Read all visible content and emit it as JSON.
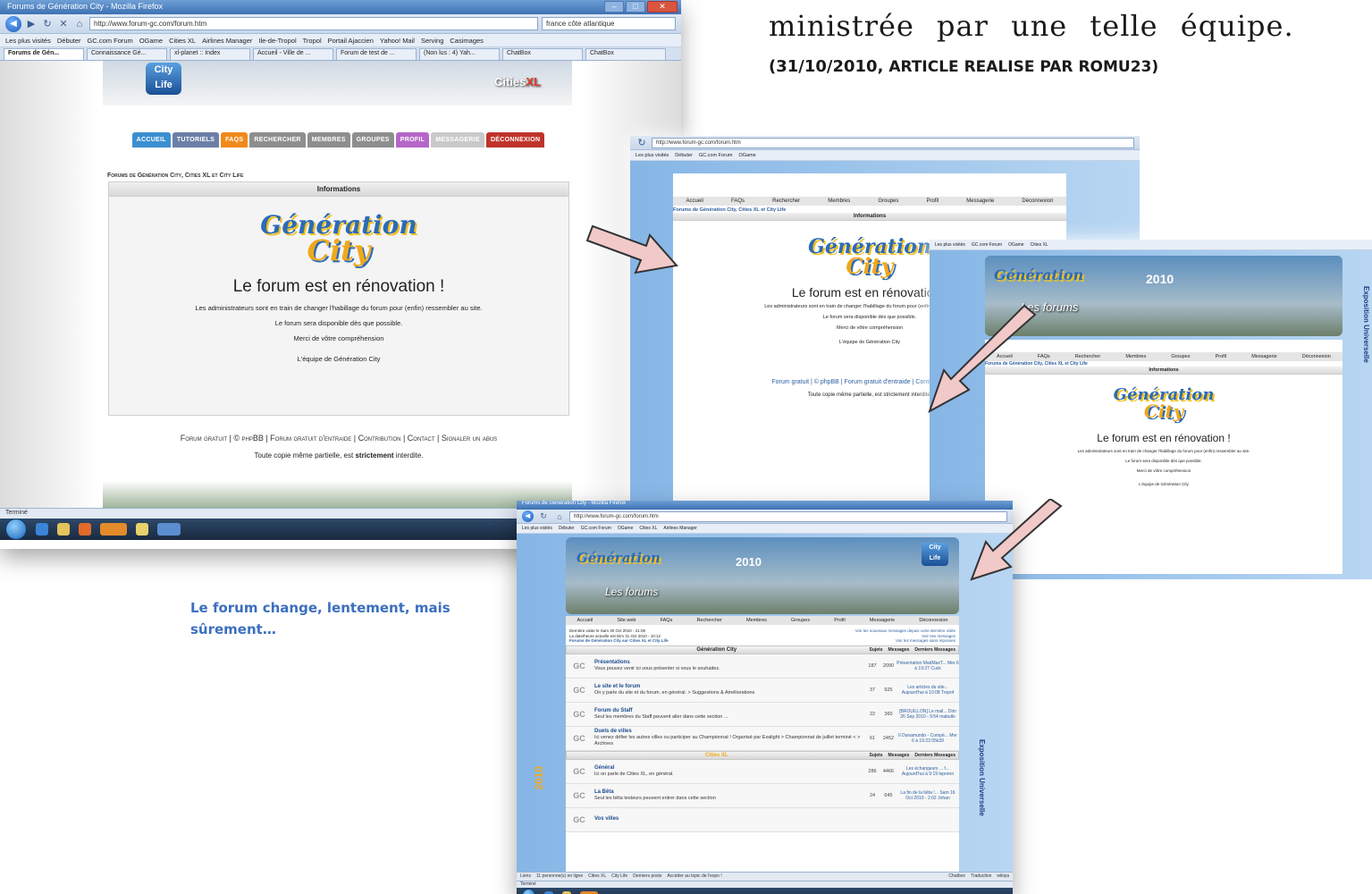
{
  "article": {
    "text_line": "ministrée par une telle équipe.",
    "credit_date": "(31/10/2010,",
    "credit_rest": " ARTICLE REALISE PAR ROMU23)"
  },
  "caption": "Le forum change, lentement, mais sûrement…",
  "browser": {
    "title": "Forums de Génération City - Mozilla Firefox",
    "url": "http://www.forum-gc.com/forum.htm",
    "search": "france côte atlantique",
    "bookmarks": [
      "Les plus visités",
      "Débuter",
      "GC.com Forum",
      "OGame",
      "Cities XL",
      "Airlines Manager",
      "Ile-de-Tropol",
      "Tropol",
      "Portail Ajaccien",
      "Yahoo! Mail",
      "Serving",
      "Casimages"
    ],
    "tabs": [
      "Forums de Gén...",
      "Connaissance Gé...",
      "xl-planet :: Index",
      "Accueil - Ville de ...",
      "Forum de test de ...",
      "(Non lus : 4) Yah...",
      "ChatBox",
      "ChatBox"
    ],
    "status": "Terminé"
  },
  "old_forum": {
    "menu": [
      "Accueil",
      "Tutoriels",
      "FAQs",
      "Rechercher",
      "Membres",
      "Groupes",
      "Profil",
      "Messagerie",
      "Déconnexion"
    ],
    "breadcrumb": "Forums de Génération City, Cities XL et City Life",
    "info_head": "Informations",
    "logo_top": "Génération",
    "logo_bottom": "City",
    "reno_title": "Le forum est en rénovation !",
    "reno_line1": "Les administrateurs sont en train de changer l'habillage du forum pour (enfin) ressembler au site.",
    "reno_line2": "Le forum sera disponible dès que possible.",
    "reno_line3": "Merci de vôtre compréhension",
    "reno_line4": "L'équipe de Génération City",
    "footer_links": "Forum gratuit | © phpBB | Forum gratuit d'entraide | Contribution | Contact | Signaler un abus",
    "copy_pre": "Toute copie même partielle, est ",
    "copy_strong": "strictement",
    "copy_post": " interdite."
  },
  "mid_forum": {
    "menu": [
      "Accueil",
      "FAQs",
      "Rechercher",
      "Membres",
      "Groupes",
      "Profil",
      "Messagerie",
      "Déconnexion"
    ],
    "footer_links": "Forum gratuit | © phpBB | Forum gratuit d'entraide | Contribution | Cont",
    "copy": "Toute copie même partielle, est strictement interdite."
  },
  "new_forum": {
    "banner_text": "Les forums",
    "banner_year": "2010",
    "banner_right": "Exposition Universelle",
    "menu": [
      "Accueil",
      "Site web",
      "FAQs",
      "Rechercher",
      "Membres",
      "Groupes",
      "Profil",
      "Messagerie",
      "Déconnexion"
    ],
    "last_visit": "Dernière visite le Sam 30 Oct 2010 - 21:06",
    "current_time": "La date/heure actuelle est Dim 31 Oct 2010 - 10:12",
    "index_link": "Forums de Génération City sur Cities XL et City Life",
    "new_msgs": "Voir les nouveaux messages depuis votre dernière visite",
    "my_msgs": "Voir ses messages",
    "unanswered": "Voir les messages sans réponses",
    "col_subjects": "Sujets",
    "col_messages": "Messages",
    "col_last": "Derniers Messages",
    "categories": [
      {
        "name": "Génération City",
        "forums": [
          {
            "title": "Présentations",
            "desc": "Vous pouvez venir ici vous présenter si vous le souhaitez.",
            "topics": "187",
            "posts": "2090",
            "last": "Présentation MadMaxT... Mer 6 à 19:27 Cuck"
          },
          {
            "title": "Le site et le forum",
            "desc": "On y parle du site et du forum, en général. > Suggestions & Améliorations",
            "topics": "37",
            "posts": "925",
            "last": "Les articles du site... Aujourd'hui à 10:08 Tropof"
          },
          {
            "title": "Forum du Staff",
            "desc": "Seul les membres du Staff peuvent aller dans cette section ...",
            "topics": "22",
            "posts": "360",
            "last": "[BROUILLON] Le mail... Dim 26 Sep 2010 - 9:54 mabullo"
          },
          {
            "title": "Duels de villes",
            "desc": "Ici venez défier les autres villes ou participer au Championnat ! Organisé par Exalight > Championnat de juillet terminé < > Archives",
            "topics": "61",
            "posts": "2452",
            "last": "Il Dunamundo - Compé... Mer 6 à 19:23 05k39"
          }
        ]
      },
      {
        "name": "Cities XL",
        "forums": [
          {
            "title": "Général",
            "desc": "Ici on parle de Cities XL, en général.",
            "topics": "286",
            "posts": "4466",
            "last": "Les échangeurs ... f... Aujourd'hui à 9:19 leprenn"
          },
          {
            "title": "La Bêta",
            "desc": "Seul les bêta testeurs peuvent entrer dans cette section",
            "topics": "24",
            "posts": "645",
            "last": "La fin de la bêta !... Sam 16 Oct 2010 - 2:02 Johan"
          },
          {
            "title": "Vos villes",
            "desc": "",
            "topics": "",
            "posts": "",
            "last": ""
          }
        ]
      }
    ],
    "statusbar_items": [
      "Liens",
      "11 personne(s) en ligne",
      "Cities XL",
      "City Life",
      "Derniers posts",
      "Accéder au topic de l'expo !"
    ],
    "statusbar_right": [
      "Chatbox",
      "Traduction",
      "wikiya"
    ]
  },
  "colors": {
    "caption": "#3b6fbf",
    "arrow_fill": "#f2c9c9",
    "forum_blue": "#2c6bb6",
    "menu_accueil": "#3b8fd0",
    "menu_tuto": "#6b7fa6",
    "menu_faq": "#f08a1a",
    "menu_default": "#8e8e8e",
    "menu_profil": "#b566c8",
    "menu_messagerie": "#c9c9c9",
    "menu_deconnexion": "#c0332b"
  }
}
